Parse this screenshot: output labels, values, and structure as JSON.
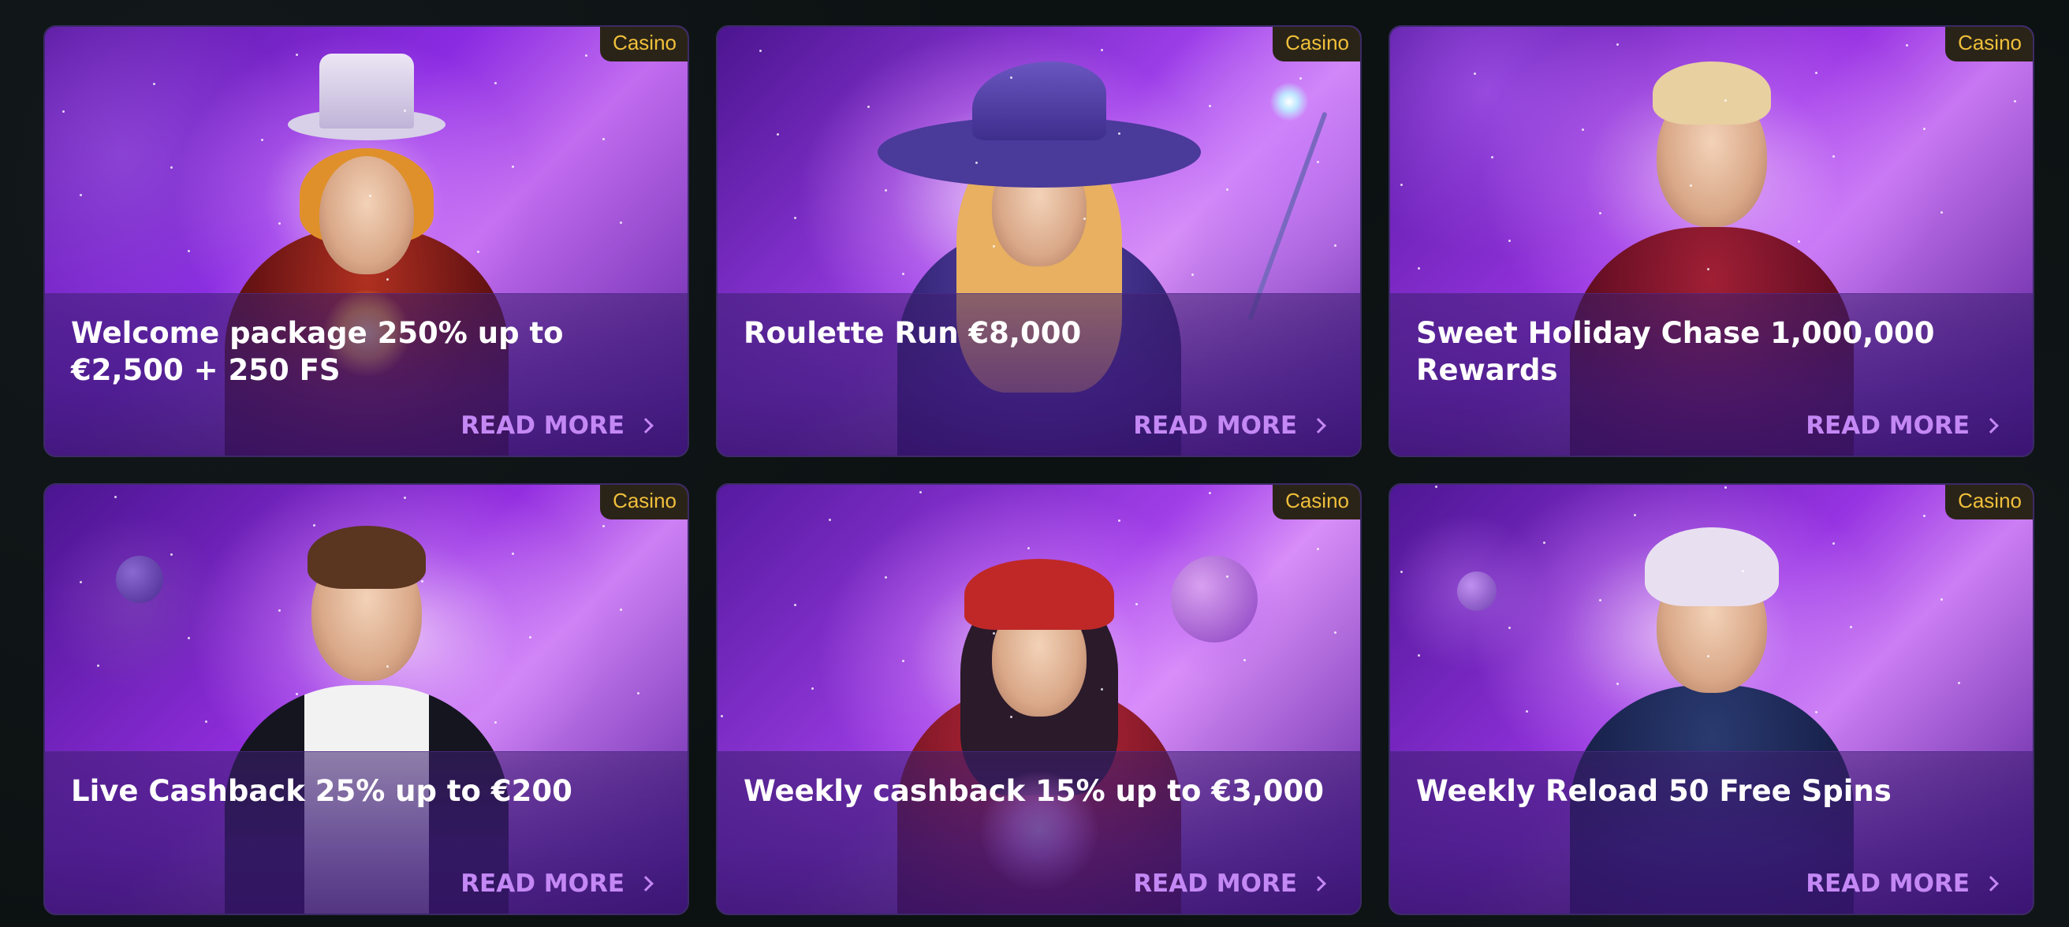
{
  "promotions": [
    {
      "badge": "Casino",
      "title": "Welcome package 250% up to €2,500 + 250 FS",
      "read_more": "READ MORE",
      "character": "magician-top-hat"
    },
    {
      "badge": "Casino",
      "title": "Roulette Run €8,000",
      "read_more": "READ MORE",
      "character": "witch-with-wand"
    },
    {
      "badge": "Casino",
      "title": "Sweet Holiday Chase 1,000,000 Rewards",
      "read_more": "READ MORE",
      "character": "mustached-gentleman"
    },
    {
      "badge": "Casino",
      "title": "Live Cashback 25% up to €200",
      "read_more": "READ MORE",
      "character": "card-dealer"
    },
    {
      "badge": "Casino",
      "title": "Weekly cashback 15% up to €3,000",
      "read_more": "READ MORE",
      "character": "fortune-teller"
    },
    {
      "badge": "Casino",
      "title": "Weekly Reload 50 Free Spins",
      "read_more": "READ MORE",
      "character": "boy-in-suit"
    }
  ],
  "colors": {
    "page_bg": "#0c1112",
    "badge_bg": "#2a2418",
    "badge_text": "#f0bf3a",
    "read_more": "#c488f5",
    "title_text": "#ffffff"
  }
}
